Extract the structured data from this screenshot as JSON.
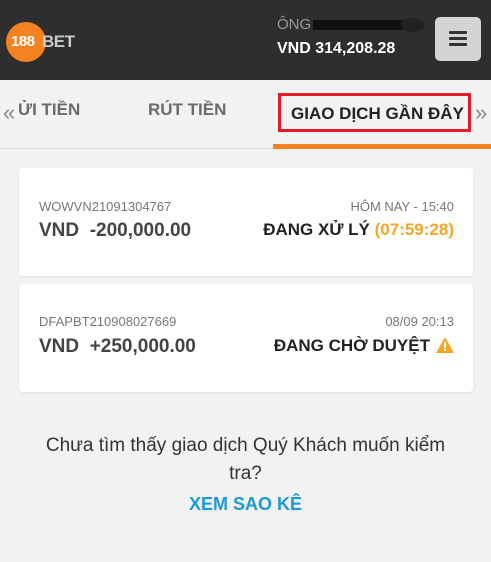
{
  "header": {
    "logo_number": "188",
    "logo_text": "BET",
    "user_label": "ÔNG",
    "balance": "VND 314,208.28",
    "menu_icon": "hamburger-menu-icon"
  },
  "tabs": {
    "prev_arrow": "«",
    "next_arrow": "»",
    "items": [
      {
        "label": "ỬI TIỀN"
      },
      {
        "label": "RÚT TIỀN"
      },
      {
        "label": "GIAO DỊCH GẦN ĐÂY"
      }
    ],
    "active_index": 2,
    "accent_color": "#f58220",
    "highlight_border_color": "#e21b24"
  },
  "transactions": [
    {
      "id": "WOWVN21091304767",
      "time": "HÔM NAY - 15:40",
      "currency": "VND",
      "amount": "-200,000.00",
      "status": "ĐANG XỬ LÝ",
      "timer": "(07:59:28)"
    },
    {
      "id": "DFAPBT210908027669",
      "time": "08/09 20:13",
      "currency": "VND",
      "amount": "+250,000.00",
      "status": "ĐANG CHỜ DUYỆT",
      "status_icon": "warning-icon"
    }
  ],
  "footer": {
    "message": "Chưa tìm thấy giao dịch Quý Khách muốn kiểm tra?",
    "link_label": "XEM SAO KÊ",
    "link_color": "#1a9ad6"
  }
}
